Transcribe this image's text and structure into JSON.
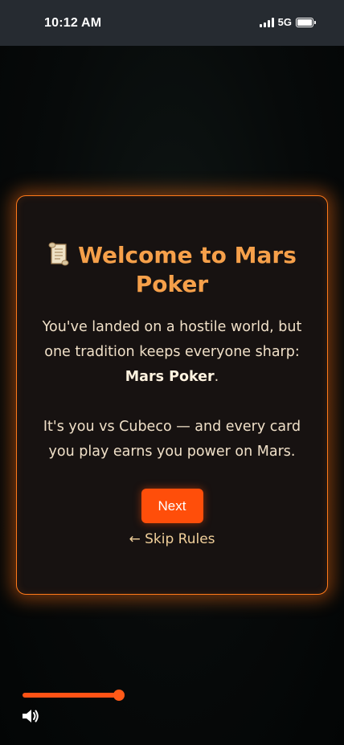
{
  "status_bar": {
    "time": "10:12 AM",
    "network": "5G"
  },
  "modal": {
    "title": "Welcome to Mars Poker",
    "title_icon": "scroll-icon",
    "p1_before": "You've landed on a hostile world, but one tradition keeps everyone sharp: ",
    "p1_bold": "Mars Poker",
    "p1_after": ".",
    "p2": "It's you vs Cubeco — and every card you play earns you power on Mars.",
    "next_label": "Next",
    "skip_label": "← Skip Rules"
  },
  "volume": {
    "level": 0.95,
    "icon": "speaker-icon"
  },
  "colors": {
    "accent": "#ff4e0a",
    "title": "#f6a04a",
    "border": "#ff7a1a"
  }
}
